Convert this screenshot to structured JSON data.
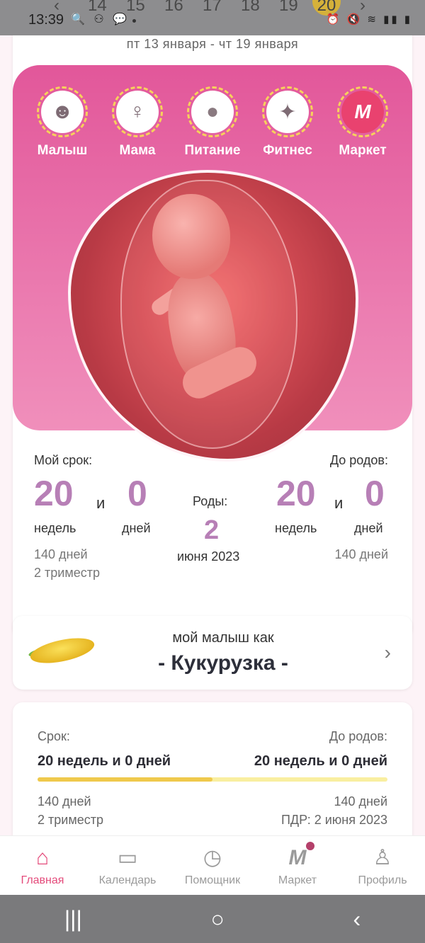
{
  "status_bar": {
    "time": "13:39",
    "left_icons": "🔍 ⚇ 💬",
    "right_icons": "⏰ 🔇 ≋ ▮▮ ▮"
  },
  "week_strip": {
    "prev": "‹",
    "next": "›",
    "days": [
      "14",
      "15",
      "16",
      "17",
      "18",
      "19",
      "20"
    ],
    "current": "20"
  },
  "date_range": "пт 13 января - чт 19 января",
  "categories": [
    {
      "label": "Малыш",
      "icon": "baby-icon",
      "glyph": "☻"
    },
    {
      "label": "Мама",
      "icon": "mother-icon",
      "glyph": "♀"
    },
    {
      "label": "Питание",
      "icon": "apple-icon",
      "glyph": "●"
    },
    {
      "label": "Фитнес",
      "icon": "fitness-icon",
      "glyph": "✦"
    },
    {
      "label": "Маркет",
      "icon": "market-icon",
      "glyph": "M"
    }
  ],
  "my_term": {
    "label": "Мой срок:",
    "weeks": "20",
    "and": "и",
    "days": "0",
    "weeks_unit": "недель",
    "days_unit": "дней",
    "total_days": "140 дней",
    "trimester": "2 триместр"
  },
  "birth": {
    "label": "Роды:",
    "day": "2",
    "month_year": "июня 2023"
  },
  "until_birth": {
    "label": "До родов:",
    "weeks": "20",
    "and": "и",
    "days": "0",
    "weeks_unit": "недель",
    "days_unit": "дней",
    "total_days": "140 дней"
  },
  "baby_size": {
    "line1": "мой малыш как",
    "line2": "- Кукурузка -",
    "chevron": "›"
  },
  "progress": {
    "term_label": "Срок:",
    "term_value": "20 недель и 0 дней",
    "until_label": "До родов:",
    "until_value": "20 недель и 0 дней",
    "fraction": 0.5,
    "days_left": "140 дней",
    "trimester": "2 триместр",
    "days_right": "140 дней",
    "pdr": "ПДР: 2 июня 2023"
  },
  "tabs": [
    {
      "label": "Главная",
      "icon": "home-icon",
      "glyph": "⌂",
      "active": true
    },
    {
      "label": "Календарь",
      "icon": "calendar-icon",
      "glyph": "▭",
      "active": false
    },
    {
      "label": "Помощник",
      "icon": "timer-icon",
      "glyph": "◷",
      "active": false
    },
    {
      "label": "Маркет",
      "icon": "market-icon",
      "glyph": "M",
      "active": false
    },
    {
      "label": "Профиль",
      "icon": "profile-icon",
      "glyph": "♙",
      "active": false
    }
  ],
  "system_nav": {
    "recent": "|||",
    "home": "○",
    "back": "‹"
  }
}
